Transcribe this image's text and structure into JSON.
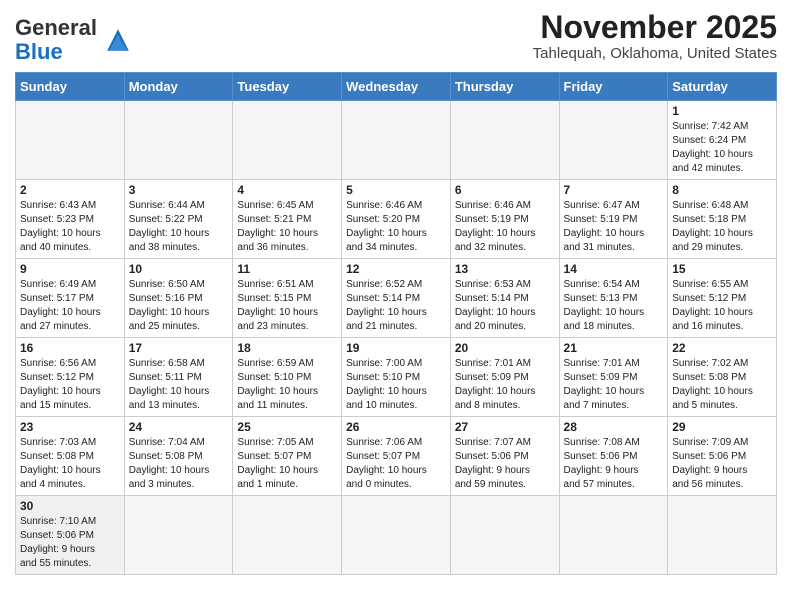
{
  "logo": {
    "text_general": "General",
    "text_blue": "Blue"
  },
  "title": "November 2025",
  "location": "Tahlequah, Oklahoma, United States",
  "weekdays": [
    "Sunday",
    "Monday",
    "Tuesday",
    "Wednesday",
    "Thursday",
    "Friday",
    "Saturday"
  ],
  "weeks": [
    [
      {
        "day": "",
        "info": ""
      },
      {
        "day": "",
        "info": ""
      },
      {
        "day": "",
        "info": ""
      },
      {
        "day": "",
        "info": ""
      },
      {
        "day": "",
        "info": ""
      },
      {
        "day": "",
        "info": ""
      },
      {
        "day": "1",
        "info": "Sunrise: 7:42 AM\nSunset: 6:24 PM\nDaylight: 10 hours\nand 42 minutes."
      }
    ],
    [
      {
        "day": "2",
        "info": "Sunrise: 6:43 AM\nSunset: 5:23 PM\nDaylight: 10 hours\nand 40 minutes."
      },
      {
        "day": "3",
        "info": "Sunrise: 6:44 AM\nSunset: 5:22 PM\nDaylight: 10 hours\nand 38 minutes."
      },
      {
        "day": "4",
        "info": "Sunrise: 6:45 AM\nSunset: 5:21 PM\nDaylight: 10 hours\nand 36 minutes."
      },
      {
        "day": "5",
        "info": "Sunrise: 6:46 AM\nSunset: 5:20 PM\nDaylight: 10 hours\nand 34 minutes."
      },
      {
        "day": "6",
        "info": "Sunrise: 6:46 AM\nSunset: 5:19 PM\nDaylight: 10 hours\nand 32 minutes."
      },
      {
        "day": "7",
        "info": "Sunrise: 6:47 AM\nSunset: 5:19 PM\nDaylight: 10 hours\nand 31 minutes."
      },
      {
        "day": "8",
        "info": "Sunrise: 6:48 AM\nSunset: 5:18 PM\nDaylight: 10 hours\nand 29 minutes."
      }
    ],
    [
      {
        "day": "9",
        "info": "Sunrise: 6:49 AM\nSunset: 5:17 PM\nDaylight: 10 hours\nand 27 minutes."
      },
      {
        "day": "10",
        "info": "Sunrise: 6:50 AM\nSunset: 5:16 PM\nDaylight: 10 hours\nand 25 minutes."
      },
      {
        "day": "11",
        "info": "Sunrise: 6:51 AM\nSunset: 5:15 PM\nDaylight: 10 hours\nand 23 minutes."
      },
      {
        "day": "12",
        "info": "Sunrise: 6:52 AM\nSunset: 5:14 PM\nDaylight: 10 hours\nand 21 minutes."
      },
      {
        "day": "13",
        "info": "Sunrise: 6:53 AM\nSunset: 5:14 PM\nDaylight: 10 hours\nand 20 minutes."
      },
      {
        "day": "14",
        "info": "Sunrise: 6:54 AM\nSunset: 5:13 PM\nDaylight: 10 hours\nand 18 minutes."
      },
      {
        "day": "15",
        "info": "Sunrise: 6:55 AM\nSunset: 5:12 PM\nDaylight: 10 hours\nand 16 minutes."
      }
    ],
    [
      {
        "day": "16",
        "info": "Sunrise: 6:56 AM\nSunset: 5:12 PM\nDaylight: 10 hours\nand 15 minutes."
      },
      {
        "day": "17",
        "info": "Sunrise: 6:58 AM\nSunset: 5:11 PM\nDaylight: 10 hours\nand 13 minutes."
      },
      {
        "day": "18",
        "info": "Sunrise: 6:59 AM\nSunset: 5:10 PM\nDaylight: 10 hours\nand 11 minutes."
      },
      {
        "day": "19",
        "info": "Sunrise: 7:00 AM\nSunset: 5:10 PM\nDaylight: 10 hours\nand 10 minutes."
      },
      {
        "day": "20",
        "info": "Sunrise: 7:01 AM\nSunset: 5:09 PM\nDaylight: 10 hours\nand 8 minutes."
      },
      {
        "day": "21",
        "info": "Sunrise: 7:01 AM\nSunset: 5:09 PM\nDaylight: 10 hours\nand 7 minutes."
      },
      {
        "day": "22",
        "info": "Sunrise: 7:02 AM\nSunset: 5:08 PM\nDaylight: 10 hours\nand 5 minutes."
      }
    ],
    [
      {
        "day": "23",
        "info": "Sunrise: 7:03 AM\nSunset: 5:08 PM\nDaylight: 10 hours\nand 4 minutes."
      },
      {
        "day": "24",
        "info": "Sunrise: 7:04 AM\nSunset: 5:08 PM\nDaylight: 10 hours\nand 3 minutes."
      },
      {
        "day": "25",
        "info": "Sunrise: 7:05 AM\nSunset: 5:07 PM\nDaylight: 10 hours\nand 1 minute."
      },
      {
        "day": "26",
        "info": "Sunrise: 7:06 AM\nSunset: 5:07 PM\nDaylight: 10 hours\nand 0 minutes."
      },
      {
        "day": "27",
        "info": "Sunrise: 7:07 AM\nSunset: 5:06 PM\nDaylight: 9 hours\nand 59 minutes."
      },
      {
        "day": "28",
        "info": "Sunrise: 7:08 AM\nSunset: 5:06 PM\nDaylight: 9 hours\nand 57 minutes."
      },
      {
        "day": "29",
        "info": "Sunrise: 7:09 AM\nSunset: 5:06 PM\nDaylight: 9 hours\nand 56 minutes."
      }
    ],
    [
      {
        "day": "30",
        "info": "Sunrise: 7:10 AM\nSunset: 5:06 PM\nDaylight: 9 hours\nand 55 minutes."
      },
      {
        "day": "",
        "info": ""
      },
      {
        "day": "",
        "info": ""
      },
      {
        "day": "",
        "info": ""
      },
      {
        "day": "",
        "info": ""
      },
      {
        "day": "",
        "info": ""
      },
      {
        "day": "",
        "info": ""
      }
    ]
  ]
}
